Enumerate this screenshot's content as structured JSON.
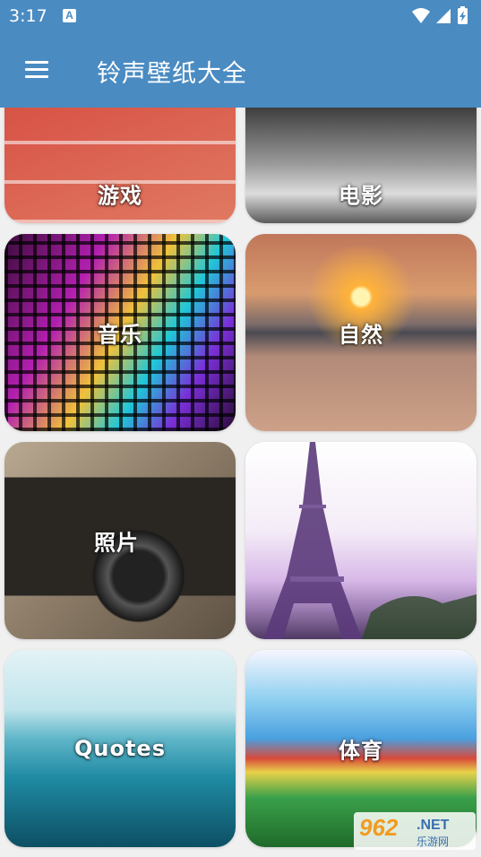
{
  "status_bar": {
    "time": "3:17",
    "notification_icon": "a-notification-icon",
    "right_icons": [
      "wifi-icon",
      "cell-signal-icon",
      "battery-charging-icon"
    ]
  },
  "app_bar": {
    "menu_icon": "menu-icon",
    "title": "铃声壁纸大全"
  },
  "categories": [
    {
      "label": "游戏",
      "image": "track-runners"
    },
    {
      "label": "电影",
      "image": "film-reel"
    },
    {
      "label": "音乐",
      "image": "colorful-equalizer"
    },
    {
      "label": "自然",
      "image": "sunset-lake"
    },
    {
      "label": "照片",
      "image": "zenit-camera"
    },
    {
      "label": "",
      "image": "eiffel-tower"
    },
    {
      "label": "Quotes",
      "image": "water-dolphin"
    },
    {
      "label": "体育",
      "image": "painted-runner"
    }
  ],
  "watermark": {
    "number": "962",
    "suffix": ".NET",
    "subtitle": "乐游网"
  },
  "colors": {
    "app_bar": "#4a8bc2",
    "background": "#f0f0f0"
  }
}
